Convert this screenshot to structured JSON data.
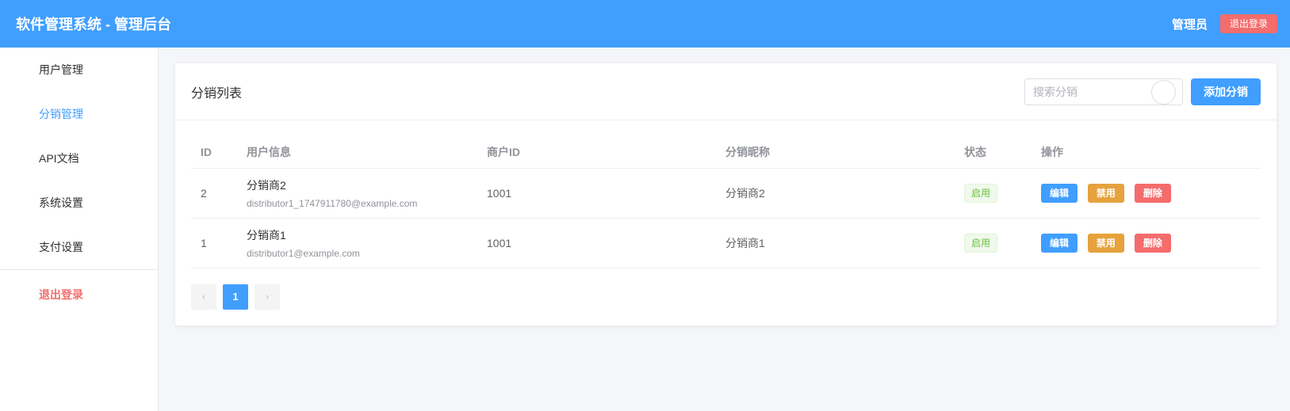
{
  "header": {
    "title": "软件管理系统 - 管理后台",
    "admin_name": "管理员",
    "logout_label": "退出登录",
    "accent_color": "#409eff"
  },
  "sidebar": {
    "items": [
      {
        "label": "用户管理"
      },
      {
        "label": "分销管理",
        "active": true
      },
      {
        "label": "API文档"
      },
      {
        "label": "系统设置"
      },
      {
        "label": "支付设置"
      }
    ],
    "logout_label": "退出登录"
  },
  "main": {
    "title": "分销列表",
    "search": {
      "placeholder": "搜索分销",
      "value": ""
    },
    "add_button_label": "添加分销",
    "table": {
      "columns": [
        "ID",
        "用户信息",
        "商户ID",
        "分销昵称",
        "状态",
        "操作"
      ],
      "rows": [
        {
          "id": "2",
          "user_name": "分销商2",
          "user_email": "distributor1_1747911780@example.com",
          "merchant_id": "1001",
          "nickname": "分销商2",
          "status": "启用"
        },
        {
          "id": "1",
          "user_name": "分销商1",
          "user_email": "distributor1@example.com",
          "merchant_id": "1001",
          "nickname": "分销商1",
          "status": "启用"
        }
      ],
      "actions": {
        "edit": "编辑",
        "disable": "禁用",
        "delete": "删除"
      }
    },
    "pagination": {
      "prev": "‹",
      "current": "1",
      "next": "›"
    }
  }
}
